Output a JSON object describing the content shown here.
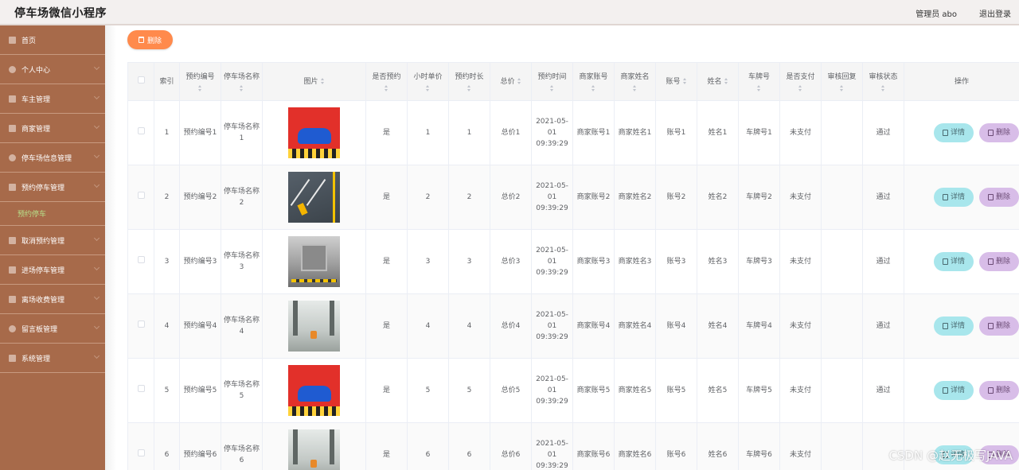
{
  "header": {
    "app_title": "停车场微信小程序",
    "admin_label": "管理员 abo",
    "logout_label": "退出登录"
  },
  "sidebar": {
    "items": [
      {
        "label": "首页",
        "icon": "home-icon"
      },
      {
        "label": "个人中心",
        "icon": "user-icon"
      },
      {
        "label": "车主管理",
        "icon": "car-icon"
      },
      {
        "label": "商家管理",
        "icon": "shop-icon"
      },
      {
        "label": "停车场信息管理",
        "icon": "user-icon"
      },
      {
        "label": "预约停车管理",
        "icon": "calendar-icon"
      },
      {
        "label": "预约停车",
        "icon": "",
        "sub": true
      },
      {
        "label": "取消预约管理",
        "icon": "flag-icon"
      },
      {
        "label": "进场停车管理",
        "icon": "enter-icon"
      },
      {
        "label": "离场收费管理",
        "icon": "grid-icon"
      },
      {
        "label": "留言板管理",
        "icon": "user-icon"
      },
      {
        "label": "系统管理",
        "icon": "settings-icon"
      }
    ]
  },
  "toolbar": {
    "delete_label": "删除"
  },
  "table": {
    "headers": {
      "index": "索引",
      "booking_no": "预约编号",
      "lot_name": "停车场名称",
      "image": "图片",
      "reserved": "是否预约",
      "hourly_price": "小时单价",
      "duration": "预约时长",
      "total": "总价",
      "time": "预约时间",
      "merchant_account": "商家账号",
      "merchant_name": "商家姓名",
      "account": "账号",
      "name": "姓名",
      "plate": "车牌号",
      "paid": "是否支付",
      "review_reply": "审核回复",
      "review_status": "审核状态",
      "actions": "操作"
    },
    "rows": [
      {
        "index": "1",
        "booking_no": "预约编号1",
        "lot_name": "停车场名称1",
        "image": "parking-ad",
        "reserved": "是",
        "hourly_price": "1",
        "duration": "1",
        "total": "总价1",
        "time": "2021-05-01 09:39:29",
        "merchant_account": "商家账号1",
        "merchant_name": "商家姓名1",
        "account": "账号1",
        "name": "姓名1",
        "plate": "车牌号1",
        "paid": "未支付",
        "review_reply": "",
        "review_status": "通过"
      },
      {
        "index": "2",
        "booking_no": "预约编号2",
        "lot_name": "停车场名称2",
        "image": "parking-lot-outdoor",
        "reserved": "是",
        "hourly_price": "2",
        "duration": "2",
        "total": "总价2",
        "time": "2021-05-01 09:39:29",
        "merchant_account": "商家账号2",
        "merchant_name": "商家姓名2",
        "account": "账号2",
        "name": "姓名2",
        "plate": "车牌号2",
        "paid": "未支付",
        "review_reply": "",
        "review_status": "通过"
      },
      {
        "index": "3",
        "booking_no": "预约编号3",
        "lot_name": "停车场名称3",
        "image": "parking-garage",
        "reserved": "是",
        "hourly_price": "3",
        "duration": "3",
        "total": "总价3",
        "time": "2021-05-01 09:39:29",
        "merchant_account": "商家账号3",
        "merchant_name": "商家姓名3",
        "account": "账号3",
        "name": "姓名3",
        "plate": "车牌号3",
        "paid": "未支付",
        "review_reply": "",
        "review_status": "通过"
      },
      {
        "index": "4",
        "booking_no": "预约编号4",
        "lot_name": "停车场名称4",
        "image": "parking-indoor",
        "reserved": "是",
        "hourly_price": "4",
        "duration": "4",
        "total": "总价4",
        "time": "2021-05-01 09:39:29",
        "merchant_account": "商家账号4",
        "merchant_name": "商家姓名4",
        "account": "账号4",
        "name": "姓名4",
        "plate": "车牌号4",
        "paid": "未支付",
        "review_reply": "",
        "review_status": "通过"
      },
      {
        "index": "5",
        "booking_no": "预约编号5",
        "lot_name": "停车场名称5",
        "image": "parking-ad",
        "reserved": "是",
        "hourly_price": "5",
        "duration": "5",
        "total": "总价5",
        "time": "2021-05-01 09:39:29",
        "merchant_account": "商家账号5",
        "merchant_name": "商家姓名5",
        "account": "账号5",
        "name": "姓名5",
        "plate": "车牌号5",
        "paid": "未支付",
        "review_reply": "",
        "review_status": "通过"
      },
      {
        "index": "6",
        "booking_no": "预约编号6",
        "lot_name": "停车场名称6",
        "image": "parking-indoor",
        "reserved": "是",
        "hourly_price": "6",
        "duration": "6",
        "total": "总价6",
        "time": "2021-05-01 09:39:29",
        "merchant_account": "商家账号6",
        "merchant_name": "商家姓名6",
        "account": "账号6",
        "name": "姓名6",
        "plate": "车牌号6",
        "paid": "未支付",
        "review_reply": "",
        "review_status": ""
      }
    ],
    "detail_label": "详情",
    "row_delete_label": "删除"
  },
  "watermark": "CSDN @赵无极写JAVA",
  "colors": {
    "sidebar_bg": "#a76a4a",
    "active_sub": "#b7e08a",
    "delete_btn": "#ff8a4c",
    "detail_btn": "#a8e6ec",
    "row_delete_btn": "#d8bde8"
  }
}
